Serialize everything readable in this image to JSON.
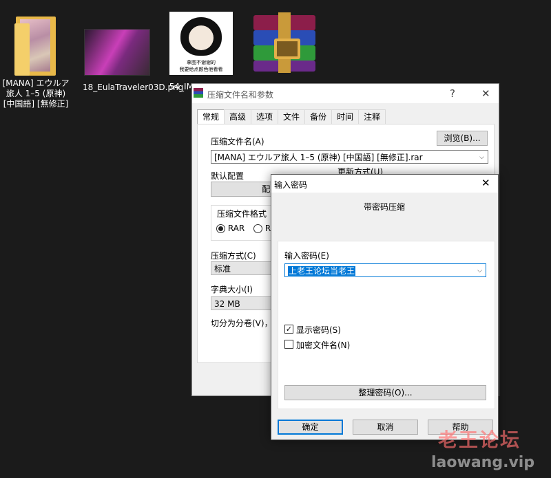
{
  "desktop": {
    "icons": [
      {
        "label": "[MANA] エウルア旅人 1–5 (原神) [中国語] [無修正]",
        "type": "folder"
      },
      {
        "label": "18_EulaTraveler03D.png",
        "type": "image"
      },
      {
        "label": "54_IMG_2085...",
        "type": "image"
      },
      {
        "label": "",
        "type": "winrar-archive"
      }
    ],
    "meme_text": [
      "拿图不谢谢的",
      "我要给点颜色他看看"
    ]
  },
  "archive_dialog": {
    "title": "压缩文件名和参数",
    "help_glyph": "?",
    "close_glyph": "✕",
    "tabs": [
      "常规",
      "高级",
      "选项",
      "文件",
      "备份",
      "时间",
      "注释"
    ],
    "active_tab": "常规",
    "archive_name_label": "压缩文件名(A)",
    "browse_button": "浏览(B)...",
    "archive_name_value": "[MANA] エウルア旅人 1–5 (原神) [中国語] [無修正].rar",
    "default_profile_label": "默认配置",
    "update_mode_label": "更新方式(U)",
    "profile_button": "配置(",
    "format_group_label": "压缩文件格式",
    "format_options": [
      "RAR",
      "RA"
    ],
    "selected_format": "RAR",
    "method_label": "压缩方式(C)",
    "method_value": "标准",
    "dict_label": "字典大小(I)",
    "dict_value": "32 MB",
    "split_label": "切分为分卷(V)，"
  },
  "password_dialog": {
    "title": "输入密码",
    "close_glyph": "✕",
    "heading": "带密码压缩",
    "enter_label": "输入密码(E)",
    "password_value": "上老王论坛当老王",
    "show_password": {
      "label": "显示密码(S)",
      "checked": true
    },
    "encrypt_names": {
      "label": "加密文件名(N)",
      "checked": false
    },
    "organize_button": "整理密码(O)...",
    "ok_button": "确定",
    "cancel_button": "取消",
    "help_button": "帮助"
  },
  "watermark": {
    "line1": "老王论坛",
    "line2": "laowang.vip"
  }
}
